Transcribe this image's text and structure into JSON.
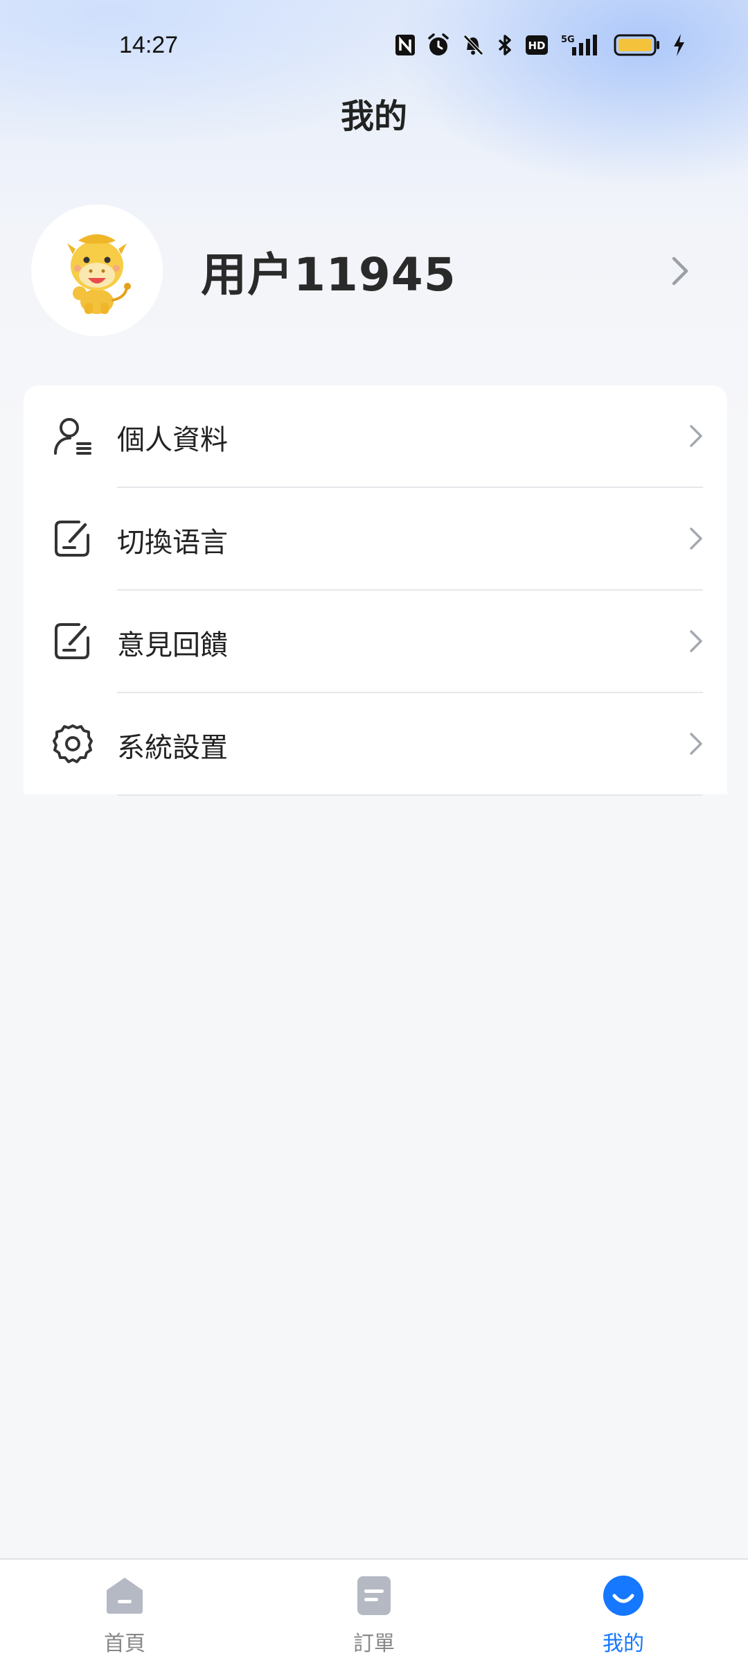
{
  "status_bar": {
    "time": "14:27",
    "icons": [
      "nfc-icon",
      "alarm-icon",
      "mute-icon",
      "bluetooth-icon",
      "hd-icon",
      "5g-signal-icon",
      "battery-icon",
      "charging-icon"
    ],
    "network": "5G",
    "hd_label": "HD"
  },
  "header": {
    "title": "我的"
  },
  "profile": {
    "username": "用户11945",
    "avatar": "cow-mascot-avatar"
  },
  "menu": {
    "items": [
      {
        "label": "個人資料",
        "icon": "user-profile-icon"
      },
      {
        "label": "切換语言",
        "icon": "edit-icon"
      },
      {
        "label": "意見回饋",
        "icon": "edit-icon"
      },
      {
        "label": "系統設置",
        "icon": "gear-icon"
      }
    ]
  },
  "tab_bar": {
    "tabs": [
      {
        "label": "首頁",
        "icon": "home-icon",
        "active": false
      },
      {
        "label": "訂單",
        "icon": "order-icon",
        "active": false
      },
      {
        "label": "我的",
        "icon": "profile-smile-icon",
        "active": true
      }
    ]
  },
  "colors": {
    "accent": "#1677ff",
    "inactive_tab": "#b4b9c4",
    "text": "#222222",
    "page_background": "#f6f7f9",
    "battery": "#f5c33b"
  }
}
